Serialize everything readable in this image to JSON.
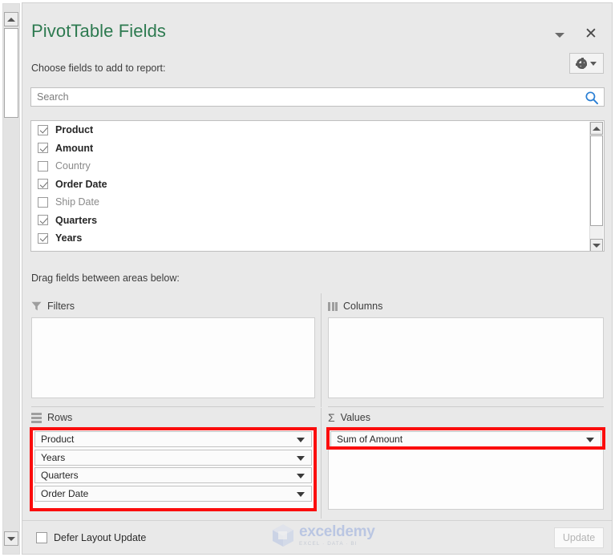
{
  "panel": {
    "title": "PivotTable Fields",
    "subtitle": "Choose fields to add to report:",
    "collapse_icon": "chevron-down-icon",
    "close_icon": "close-icon",
    "tools_icon": "gear-icon",
    "tools_caret_icon": "chevron-down-icon"
  },
  "search": {
    "placeholder": "Search",
    "value": "",
    "icon": "search-icon",
    "icon_color": "#2a7fd4"
  },
  "fields": [
    {
      "label": "Product",
      "checked": true
    },
    {
      "label": "Amount",
      "checked": true
    },
    {
      "label": "Country",
      "checked": false
    },
    {
      "label": "Order Date",
      "checked": true
    },
    {
      "label": "Ship Date",
      "checked": false
    },
    {
      "label": "Quarters",
      "checked": true
    },
    {
      "label": "Years",
      "checked": true
    }
  ],
  "areas": {
    "note": "Drag fields between areas below:",
    "filters": {
      "label": "Filters",
      "icon": "funnel-icon",
      "items": []
    },
    "columns": {
      "label": "Columns",
      "icon": "columns-icon",
      "items": []
    },
    "rows": {
      "label": "Rows",
      "icon": "rows-icon",
      "items": [
        {
          "label": "Product"
        },
        {
          "label": "Years"
        },
        {
          "label": "Quarters"
        },
        {
          "label": "Order Date"
        }
      ]
    },
    "values": {
      "label": "Values",
      "icon": "sigma-icon",
      "items": [
        {
          "label": "Sum of Amount"
        }
      ]
    }
  },
  "annotations": {
    "color": "#fb0d0d",
    "rows_highlight": true,
    "values_highlight": true
  },
  "footer": {
    "defer_label": "Defer Layout Update",
    "defer_checked": false,
    "update_label": "Update",
    "update_disabled": true
  },
  "watermark": {
    "name": "exceldemy",
    "tagline": "EXCEL · DATA · BI"
  },
  "scrollbars": {
    "worksheet": {
      "up_icon": "caret-up-icon",
      "down_icon": "caret-down-icon"
    },
    "field_list": {
      "up_icon": "caret-up-icon",
      "down_icon": "caret-down-icon"
    }
  }
}
